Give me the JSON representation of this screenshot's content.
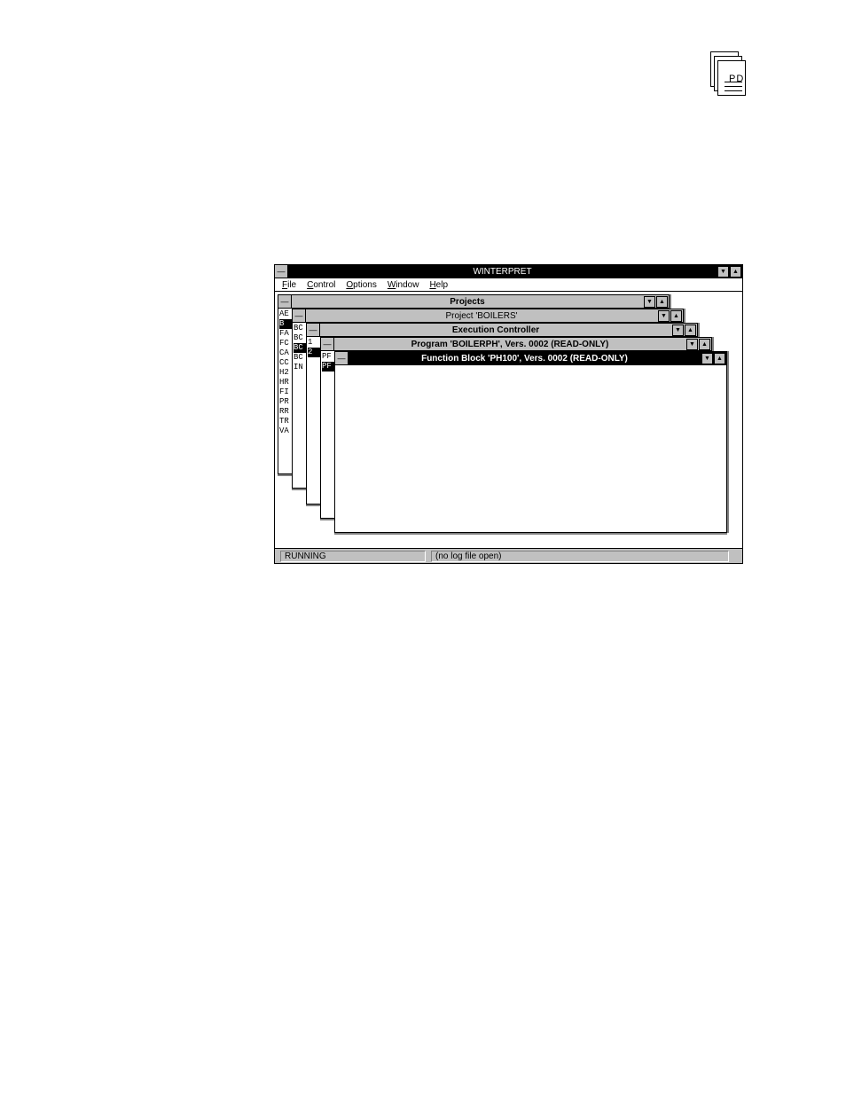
{
  "corner_icon": {
    "text": "PD",
    "name": "document-stack-icon"
  },
  "app": {
    "title": "WINTERPRET",
    "sys_glyph": "—",
    "min_glyph": "▼",
    "max_glyph": "▲",
    "menu": [
      "File",
      "Control",
      "Options",
      "Window",
      "Help"
    ],
    "status": [
      "RUNNING",
      "(no log file open)"
    ]
  },
  "windows": {
    "projects": {
      "title": "Projects",
      "items": [
        "AE",
        "B",
        "FA",
        "FC",
        "CA",
        "CC",
        "H2",
        "HR",
        "FI",
        "PR",
        "RR",
        "TR",
        "VA"
      ],
      "selected_index": 1
    },
    "project_boilers": {
      "title": "Project 'BOILERS'",
      "items": [
        "BC",
        "BC",
        "BC",
        "BC",
        "IN"
      ],
      "selected_index": 2
    },
    "execution_controller": {
      "title": "Execution Controller",
      "items": [
        "1",
        "2"
      ],
      "selected_index": 1
    },
    "program": {
      "title": "Program 'BOILERPH', Vers. 0002 (READ-ONLY)",
      "items": [
        "PF",
        "PF"
      ],
      "selected_index": 1
    },
    "function_block": {
      "title": "Function Block 'PH100', Vers. 0002 (READ-ONLY)"
    }
  }
}
